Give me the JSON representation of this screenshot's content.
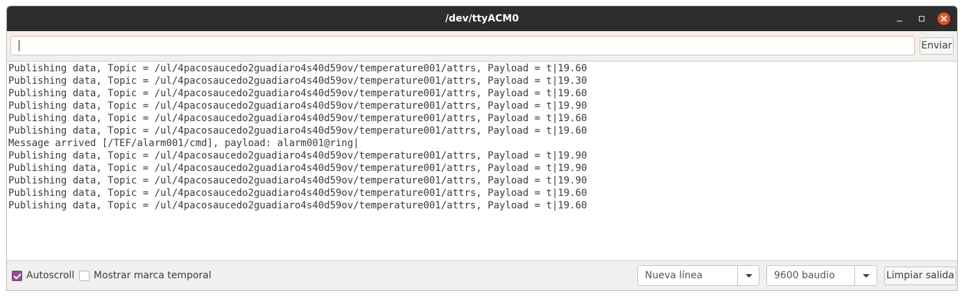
{
  "window": {
    "title": "/dev/ttyACM0"
  },
  "send": {
    "input_value": "",
    "button_label": "Enviar"
  },
  "output": {
    "lines": [
      "Publishing data, Topic = /ul/4pacosaucedo2guadiaro4s40d59ov/temperature001/attrs, Payload = t|19.60",
      "Publishing data, Topic = /ul/4pacosaucedo2guadiaro4s40d59ov/temperature001/attrs, Payload = t|19.30",
      "Publishing data, Topic = /ul/4pacosaucedo2guadiaro4s40d59ov/temperature001/attrs, Payload = t|19.60",
      "Publishing data, Topic = /ul/4pacosaucedo2guadiaro4s40d59ov/temperature001/attrs, Payload = t|19.90",
      "Publishing data, Topic = /ul/4pacosaucedo2guadiaro4s40d59ov/temperature001/attrs, Payload = t|19.60",
      "Publishing data, Topic = /ul/4pacosaucedo2guadiaro4s40d59ov/temperature001/attrs, Payload = t|19.60",
      "Message arrived [/TEF/alarm001/cmd], payload: alarm001@ring|",
      "Publishing data, Topic = /ul/4pacosaucedo2guadiaro4s40d59ov/temperature001/attrs, Payload = t|19.90",
      "Publishing data, Topic = /ul/4pacosaucedo2guadiaro4s40d59ov/temperature001/attrs, Payload = t|19.90",
      "Publishing data, Topic = /ul/4pacosaucedo2guadiaro4s40d59ov/temperature001/attrs, Payload = t|19.90",
      "Publishing data, Topic = /ul/4pacosaucedo2guadiaro4s40d59ov/temperature001/attrs, Payload = t|19.60",
      "Publishing data, Topic = /ul/4pacosaucedo2guadiaro4s40d59ov/temperature001/attrs, Payload = t|19.60"
    ]
  },
  "footer": {
    "autoscroll": {
      "label": "Autoscroll",
      "checked": true
    },
    "timestamp": {
      "label": "Mostrar marca temporal",
      "checked": false
    },
    "line_ending": {
      "selected": "Nueva línea"
    },
    "baud_rate": {
      "selected": "9600 baudio"
    },
    "clear_label": "Limpiar salida"
  },
  "colors": {
    "titlebar": "#2d2d2d",
    "close_button": "#e95420",
    "checkbox_accent": "#924d8b",
    "input_focus_border": "#e8b9a6"
  }
}
